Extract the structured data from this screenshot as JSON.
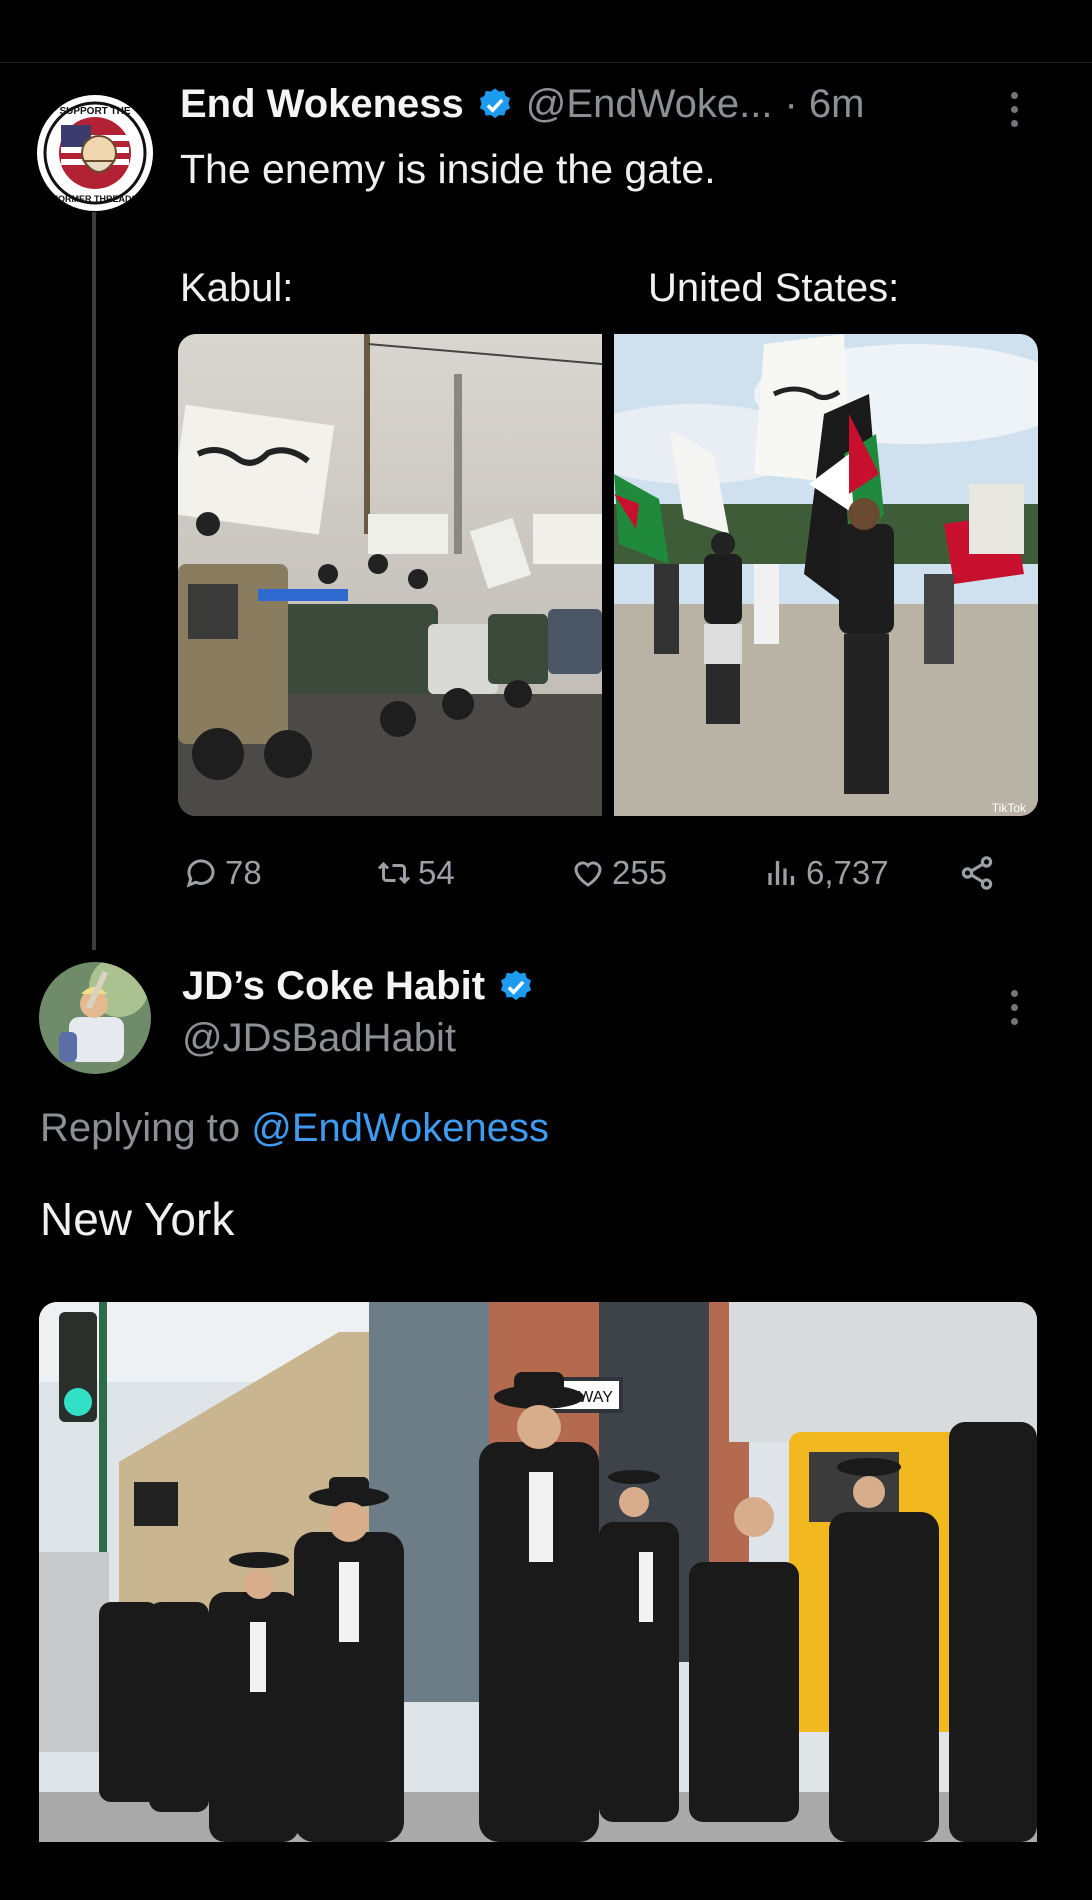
{
  "post": {
    "display_name": "End Wokeness",
    "handle": "@EndWoke...",
    "time": "· 6m",
    "text": "The enemy is inside the gate.",
    "label_left": "Kabul:",
    "label_right": "United States:",
    "badge_text_top": "SUPPORT THE",
    "badge_text_bottom": "FORMER THREADS",
    "image_right_watermark": "TikTok",
    "actions": {
      "replies": "78",
      "reposts": "54",
      "likes": "255",
      "views": "6,737"
    }
  },
  "reply": {
    "display_name": "JD’s Coke Habit",
    "handle": "@JDsBadHabit",
    "replying_prefix": "Replying to ",
    "replying_to": "@EndWokeness",
    "text": "New York",
    "sign_one_way": "ONE WAY"
  },
  "colors": {
    "background": "#000000",
    "verified": "#1d9bf0",
    "link": "#3f9bf0",
    "secondary_text": "#8b9096"
  },
  "icons": [
    "verified-badge-icon",
    "more-options-icon",
    "reply-icon",
    "repost-icon",
    "like-icon",
    "views-icon",
    "share-icon"
  ]
}
